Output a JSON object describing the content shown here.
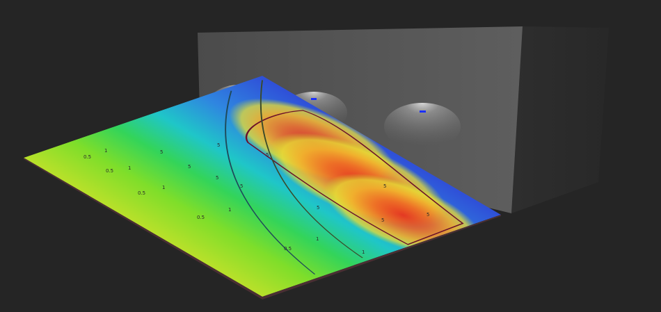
{
  "scene": {
    "colors": {
      "background": "#252525",
      "wall_light": "#5a5a5a",
      "wall_dark": "#3a3a3a",
      "side_wall": "#2c2c2c",
      "floor_edge": "#5a3a3a",
      "luminaire": "#1a2fff"
    },
    "luminaires": [
      {
        "name": "luminaire-1"
      },
      {
        "name": "luminaire-2"
      },
      {
        "name": "luminaire-3"
      }
    ],
    "isolines": {
      "inner": {
        "value": 5,
        "labels": [
          "5",
          "5",
          "5",
          "5",
          "5",
          "5",
          "5",
          "5",
          "5",
          "5"
        ]
      },
      "mid": {
        "value": 1,
        "labels": [
          "1",
          "1",
          "1",
          "1",
          "1",
          "1"
        ]
      },
      "outer": {
        "value": 0.5,
        "labels": [
          "0.5",
          "0.5",
          "0.5",
          "0.5",
          "0.5"
        ]
      }
    }
  }
}
